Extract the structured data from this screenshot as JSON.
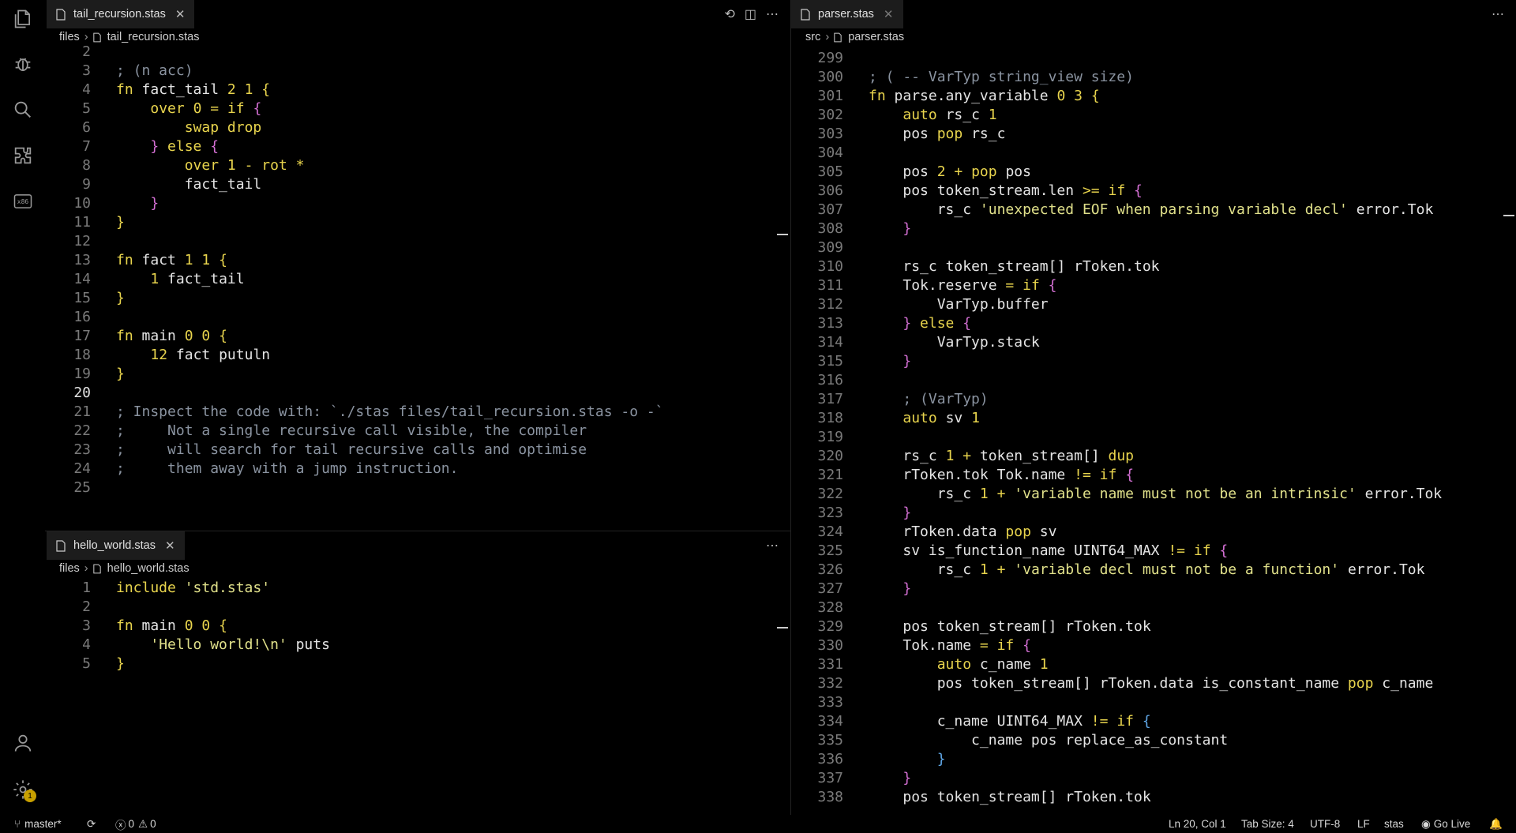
{
  "colors": {
    "keyword": "#e8d44d",
    "bracket_purple": "#d36fd3",
    "bracket_blue": "#60a8e8",
    "string": "#e0e08a",
    "comment": "#8a93a0",
    "badge": "#c8a000"
  },
  "activity_bar": {
    "icons": [
      "files-icon",
      "debug-icon",
      "search-icon",
      "extensions-icon",
      "x86-icon",
      "account-icon",
      "settings-icon"
    ],
    "x86_label": "x86",
    "settings_badge": "1"
  },
  "left_top": {
    "tab": "tail_recursion.stas",
    "breadcrumb": {
      "folder": "files",
      "file": "tail_recursion.stas"
    },
    "lines": [
      {
        "n": "2",
        "t": ""
      },
      {
        "n": "3",
        "t": "; (n acc)"
      },
      {
        "n": "4",
        "t": "fn fact_tail 2 1 {"
      },
      {
        "n": "5",
        "t": "    over 0 = if {"
      },
      {
        "n": "6",
        "t": "        swap drop"
      },
      {
        "n": "7",
        "t": "    } else {"
      },
      {
        "n": "8",
        "t": "        over 1 - rot *"
      },
      {
        "n": "9",
        "t": "        fact_tail"
      },
      {
        "n": "10",
        "t": "    }"
      },
      {
        "n": "11",
        "t": "}"
      },
      {
        "n": "12",
        "t": ""
      },
      {
        "n": "13",
        "t": "fn fact 1 1 {"
      },
      {
        "n": "14",
        "t": "    1 fact_tail"
      },
      {
        "n": "15",
        "t": "}"
      },
      {
        "n": "16",
        "t": ""
      },
      {
        "n": "17",
        "t": "fn main 0 0 {"
      },
      {
        "n": "18",
        "t": "    12 fact putuln"
      },
      {
        "n": "19",
        "t": "}"
      },
      {
        "n": "20",
        "t": ""
      },
      {
        "n": "21",
        "t": "; Inspect the code with: `./stas files/tail_recursion.stas -o -`"
      },
      {
        "n": "22",
        "t": ";     Not a single recursive call visible, the compiler"
      },
      {
        "n": "23",
        "t": ";     will search for tail recursive calls and optimise"
      },
      {
        "n": "24",
        "t": ";     them away with a jump instruction."
      },
      {
        "n": "25",
        "t": ""
      }
    ]
  },
  "left_bottom": {
    "tab": "hello_world.stas",
    "breadcrumb": {
      "folder": "files",
      "file": "hello_world.stas"
    },
    "lines": [
      {
        "n": "1",
        "t": "include 'std.stas'"
      },
      {
        "n": "2",
        "t": ""
      },
      {
        "n": "3",
        "t": "fn main 0 0 {"
      },
      {
        "n": "4",
        "t": "    'Hello world!\\n' puts"
      },
      {
        "n": "5",
        "t": "}"
      }
    ]
  },
  "right": {
    "tab": "parser.stas",
    "breadcrumb": {
      "folder": "src",
      "file": "parser.stas"
    },
    "lines": [
      {
        "n": "299",
        "t": ""
      },
      {
        "n": "300",
        "t": "; ( -- VarTyp string_view size)"
      },
      {
        "n": "301",
        "t": "fn parse.any_variable 0 3 {"
      },
      {
        "n": "302",
        "t": "    auto rs_c 1"
      },
      {
        "n": "303",
        "t": "    pos pop rs_c"
      },
      {
        "n": "304",
        "t": ""
      },
      {
        "n": "305",
        "t": "    pos 2 + pop pos"
      },
      {
        "n": "306",
        "t": "    pos token_stream.len >= if {"
      },
      {
        "n": "307",
        "t": "        rs_c 'unexpected EOF when parsing variable decl' error.Tok"
      },
      {
        "n": "308",
        "t": "    }"
      },
      {
        "n": "309",
        "t": ""
      },
      {
        "n": "310",
        "t": "    rs_c token_stream[] rToken.tok"
      },
      {
        "n": "311",
        "t": "    Tok.reserve = if {"
      },
      {
        "n": "312",
        "t": "        VarTyp.buffer"
      },
      {
        "n": "313",
        "t": "    } else {"
      },
      {
        "n": "314",
        "t": "        VarTyp.stack"
      },
      {
        "n": "315",
        "t": "    }"
      },
      {
        "n": "316",
        "t": ""
      },
      {
        "n": "317",
        "t": "    ; (VarTyp)"
      },
      {
        "n": "318",
        "t": "    auto sv 1"
      },
      {
        "n": "319",
        "t": ""
      },
      {
        "n": "320",
        "t": "    rs_c 1 + token_stream[] dup"
      },
      {
        "n": "321",
        "t": "    rToken.tok Tok.name != if {"
      },
      {
        "n": "322",
        "t": "        rs_c 1 + 'variable name must not be an intrinsic' error.Tok"
      },
      {
        "n": "323",
        "t": "    }"
      },
      {
        "n": "324",
        "t": "    rToken.data pop sv"
      },
      {
        "n": "325",
        "t": "    sv is_function_name UINT64_MAX != if {"
      },
      {
        "n": "326",
        "t": "        rs_c 1 + 'variable decl must not be a function' error.Tok"
      },
      {
        "n": "327",
        "t": "    }"
      },
      {
        "n": "328",
        "t": ""
      },
      {
        "n": "329",
        "t": "    pos token_stream[] rToken.tok"
      },
      {
        "n": "330",
        "t": "    Tok.name = if {"
      },
      {
        "n": "331",
        "t": "        auto c_name 1"
      },
      {
        "n": "332",
        "t": "        pos token_stream[] rToken.data is_constant_name pop c_name"
      },
      {
        "n": "333",
        "t": ""
      },
      {
        "n": "334",
        "t": "        c_name UINT64_MAX != if {"
      },
      {
        "n": "335",
        "t": "            c_name pos replace_as_constant"
      },
      {
        "n": "336",
        "t": "        }"
      },
      {
        "n": "337",
        "t": "    }"
      },
      {
        "n": "338",
        "t": "    pos token_stream[] rToken.tok"
      }
    ]
  },
  "status_bar": {
    "branch": "master*",
    "errors": "0",
    "warnings": "0",
    "cursor": "Ln 20, Col 1",
    "tab_size": "Tab Size: 4",
    "encoding": "UTF-8",
    "eol": "LF",
    "language": "stas",
    "go_live": "Go Live"
  }
}
